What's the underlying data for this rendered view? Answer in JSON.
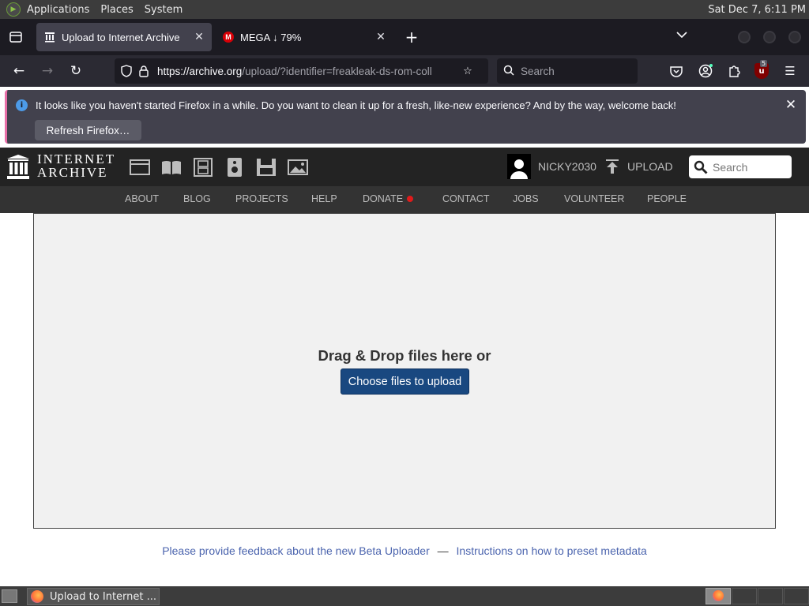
{
  "system_panel": {
    "menus": [
      "Applications",
      "Places",
      "System"
    ],
    "clock": "Sat Dec  7,  6:11 PM"
  },
  "browser": {
    "tabs": [
      {
        "title": "Upload to Internet Archive",
        "active": true
      },
      {
        "title": "MEGA ↓ 79%",
        "active": false
      }
    ],
    "url_host": "https://archive.org",
    "url_path": "/upload/?identifier=freakleak-ds-rom-coll",
    "search_placeholder": "Search",
    "extension_badge": "5"
  },
  "notification": {
    "message": "It looks like you haven't started Firefox in a while. Do you want to clean it up for a fresh, like-new experience? And by the way, welcome back!",
    "button": "Refresh Firefox…"
  },
  "ia_header": {
    "logo_line1": "INTERNET",
    "logo_line2": "ARCHIVE",
    "media_icons": [
      "web-icon",
      "texts-icon",
      "video-icon",
      "audio-icon",
      "software-icon",
      "images-icon"
    ],
    "username": "NICKY2030",
    "upload_label": "UPLOAD",
    "search_placeholder": "Search"
  },
  "ia_nav": [
    "ABOUT",
    "BLOG",
    "PROJECTS",
    "HELP",
    "DONATE",
    "CONTACT",
    "JOBS",
    "VOLUNTEER",
    "PEOPLE"
  ],
  "upload": {
    "drop_text": "Drag & Drop files here or",
    "choose_button": "Choose files to upload"
  },
  "footer_links": {
    "feedback": "Please provide feedback about the new Beta Uploader",
    "separator": "—",
    "instructions": "Instructions on how to preset metadata"
  },
  "taskbar": {
    "window_title": "Upload to Internet ..."
  },
  "colors": {
    "ia_header_bg": "#232323",
    "ia_nav_bg": "#333333",
    "upload_button": "#194880",
    "link": "#4b64ae",
    "donate_dot": "#e01b1b"
  }
}
